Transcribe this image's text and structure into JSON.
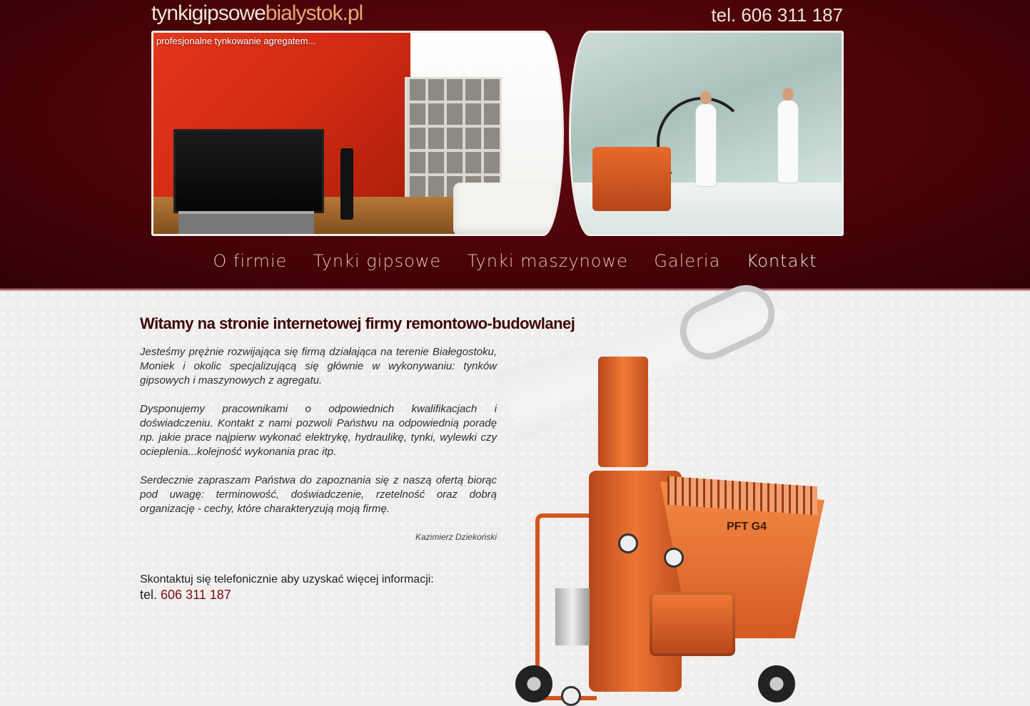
{
  "header": {
    "logo_part1": "tynkigipsowe",
    "logo_part2": "bialystok.pl",
    "phone": "tel. 606 311 187",
    "banner_caption": "profesjonalne tynkowanie agregatem..."
  },
  "nav": {
    "items": [
      "O firmie",
      "Tynki gipsowe",
      "Tynki maszynowe",
      "Galeria",
      "Kontakt"
    ]
  },
  "main": {
    "headline": "Witamy na stronie internetowej firmy remontowo-budowlanej",
    "paragraphs": [
      "Jesteśmy prężnie rozwijająca się firmą działająca na terenie Białegostoku, Moniek i okolic specjalizującą się głównie w wykonywaniu: tynków gipsowych i maszynowych z agregatu.",
      "Dysponujemy pracownikami o odpowiednich kwalifikacjach i doświadczeniu. Kontakt z nami pozwoli Państwu na odpowiednią poradę np. jakie prace najpierw wykonać elektrykę, hydraulikę, tynki, wylewki czy ocieplenia...kolejność wykonania prac itp.",
      "Serdecznie zapraszam Państwa do zapoznania się z naszą ofertą biorąc pod uwagę: terminowość, doświadczenie, rzetelność oraz dobrą organizację - cechy, które charakteryzują moją firmę."
    ],
    "signature": "Kazimierz Dziekoński",
    "contact_text": "Skontaktuj się telefonicznie aby uzyskać więcej informacji:",
    "contact_prefix": "tel.",
    "contact_number": "606 311 187",
    "machine_label": "PFT G4"
  },
  "colors": {
    "header_bg": "#4a0309",
    "headline": "#3c0509",
    "phone_accent": "#7a0c14",
    "logo_accent": "#e8a878"
  }
}
